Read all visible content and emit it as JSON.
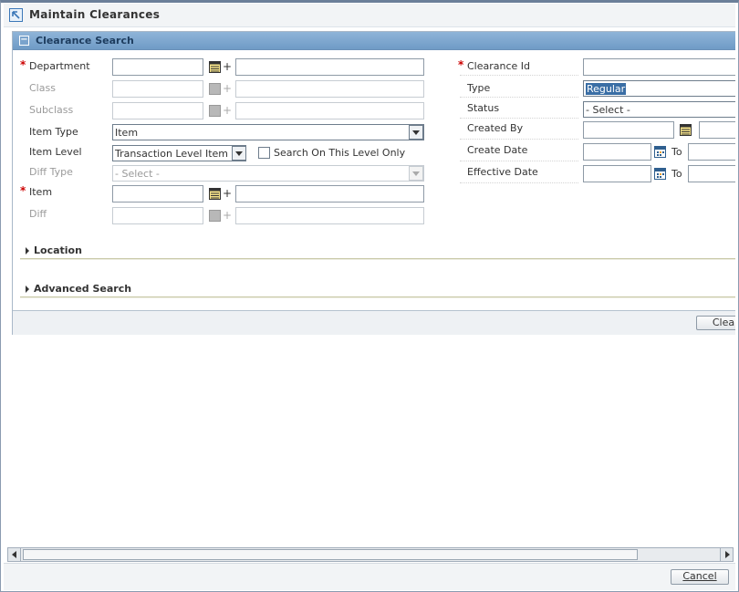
{
  "window": {
    "title": "Maintain Clearances"
  },
  "panel": {
    "title": "Clearance Search",
    "collapse_symbol": "−"
  },
  "left_fields": {
    "department": {
      "label": "Department",
      "value": "",
      "desc": ""
    },
    "class": {
      "label": "Class",
      "value": "",
      "desc": ""
    },
    "subclass": {
      "label": "Subclass",
      "value": "",
      "desc": ""
    },
    "item_type": {
      "label": "Item Type",
      "value": "Item"
    },
    "item_level": {
      "label": "Item Level",
      "value": "Transaction Level Item",
      "checkbox_label": "Search On This Level Only",
      "checked": false
    },
    "diff_type": {
      "label": "Diff Type",
      "value": "- Select -"
    },
    "item": {
      "label": "Item",
      "value": "",
      "desc": ""
    },
    "diff": {
      "label": "Diff",
      "value": "",
      "desc": ""
    }
  },
  "right_fields": {
    "clearance_id": {
      "label": "Clearance Id",
      "value": ""
    },
    "type": {
      "label": "Type",
      "value": "Regular"
    },
    "status": {
      "label": "Status",
      "value": "- Select -"
    },
    "created_by": {
      "label": "Created By",
      "value": "",
      "desc": ""
    },
    "create_date": {
      "label": "Create Date",
      "from": "",
      "to_label": "To",
      "to": ""
    },
    "effective_date": {
      "label": "Effective Date",
      "from": "",
      "to_label": "To",
      "to": ""
    }
  },
  "required_marker": "*",
  "plus_sign": "+",
  "sections": {
    "location": "Location",
    "advanced_search": "Advanced Search"
  },
  "footer": {
    "clear_button": "Clea"
  },
  "bottom": {
    "cancel_button": "Cancel"
  },
  "colors": {
    "panel_header": "#7aa3cc",
    "required": "#cc0000",
    "selection": "#3a6ea5"
  },
  "icons": [
    "maximize-icon",
    "collapse-icon",
    "lov-icon",
    "calendar-icon",
    "chevron-down-icon",
    "triangle-right-icon",
    "scroll-left-icon",
    "scroll-right-icon"
  ]
}
